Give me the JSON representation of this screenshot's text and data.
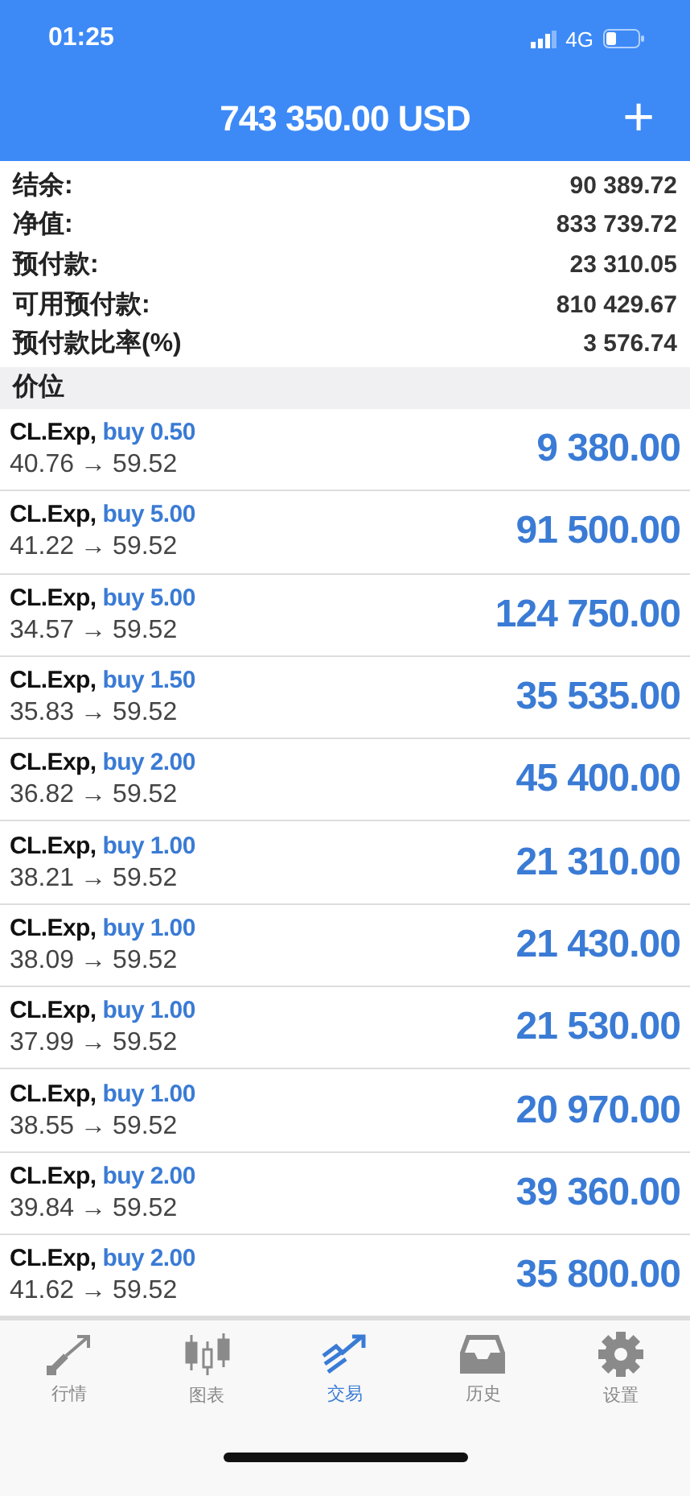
{
  "status_bar": {
    "time": "01:25",
    "network": "4G"
  },
  "header": {
    "title": "743 350.00 USD",
    "add": "+"
  },
  "summary": [
    {
      "label": "结余:",
      "value": "90 389.72"
    },
    {
      "label": "净值:",
      "value": "833 739.72"
    },
    {
      "label": "预付款:",
      "value": "23 310.05"
    },
    {
      "label": "可用预付款:",
      "value": "810 429.67"
    },
    {
      "label": "预付款比率(%)",
      "value": "3 576.74"
    }
  ],
  "section": {
    "title": "价位"
  },
  "positions": [
    {
      "symbol": "CL.Exp,",
      "side": "buy 0.50",
      "open": "40.76",
      "arrow": "→",
      "current": "59.52",
      "profit": "9 380.00"
    },
    {
      "symbol": "CL.Exp,",
      "side": "buy 5.00",
      "open": "41.22",
      "arrow": "→",
      "current": "59.52",
      "profit": "91 500.00"
    },
    {
      "symbol": "CL.Exp,",
      "side": "buy 5.00",
      "open": "34.57",
      "arrow": "→",
      "current": "59.52",
      "profit": "124 750.00"
    },
    {
      "symbol": "CL.Exp,",
      "side": "buy 1.50",
      "open": "35.83",
      "arrow": "→",
      "current": "59.52",
      "profit": "35 535.00"
    },
    {
      "symbol": "CL.Exp,",
      "side": "buy 2.00",
      "open": "36.82",
      "arrow": "→",
      "current": "59.52",
      "profit": "45 400.00"
    },
    {
      "symbol": "CL.Exp,",
      "side": "buy 1.00",
      "open": "38.21",
      "arrow": "→",
      "current": "59.52",
      "profit": "21 310.00"
    },
    {
      "symbol": "CL.Exp,",
      "side": "buy 1.00",
      "open": "38.09",
      "arrow": "→",
      "current": "59.52",
      "profit": "21 430.00"
    },
    {
      "symbol": "CL.Exp,",
      "side": "buy 1.00",
      "open": "37.99",
      "arrow": "→",
      "current": "59.52",
      "profit": "21 530.00"
    },
    {
      "symbol": "CL.Exp,",
      "side": "buy 1.00",
      "open": "38.55",
      "arrow": "→",
      "current": "59.52",
      "profit": "20 970.00"
    },
    {
      "symbol": "CL.Exp,",
      "side": "buy 2.00",
      "open": "39.84",
      "arrow": "→",
      "current": "59.52",
      "profit": "39 360.00"
    },
    {
      "symbol": "CL.Exp,",
      "side": "buy 2.00",
      "open": "41.62",
      "arrow": "→",
      "current": "59.52",
      "profit": "35 800.00"
    }
  ],
  "tabs": [
    {
      "kind": "quotes",
      "label": "行情",
      "selected": false
    },
    {
      "kind": "chart",
      "label": "图表",
      "selected": false
    },
    {
      "kind": "trade",
      "label": "交易",
      "selected": true
    },
    {
      "kind": "history",
      "label": "历史",
      "selected": false
    },
    {
      "kind": "settings",
      "label": "设置",
      "selected": false
    }
  ]
}
